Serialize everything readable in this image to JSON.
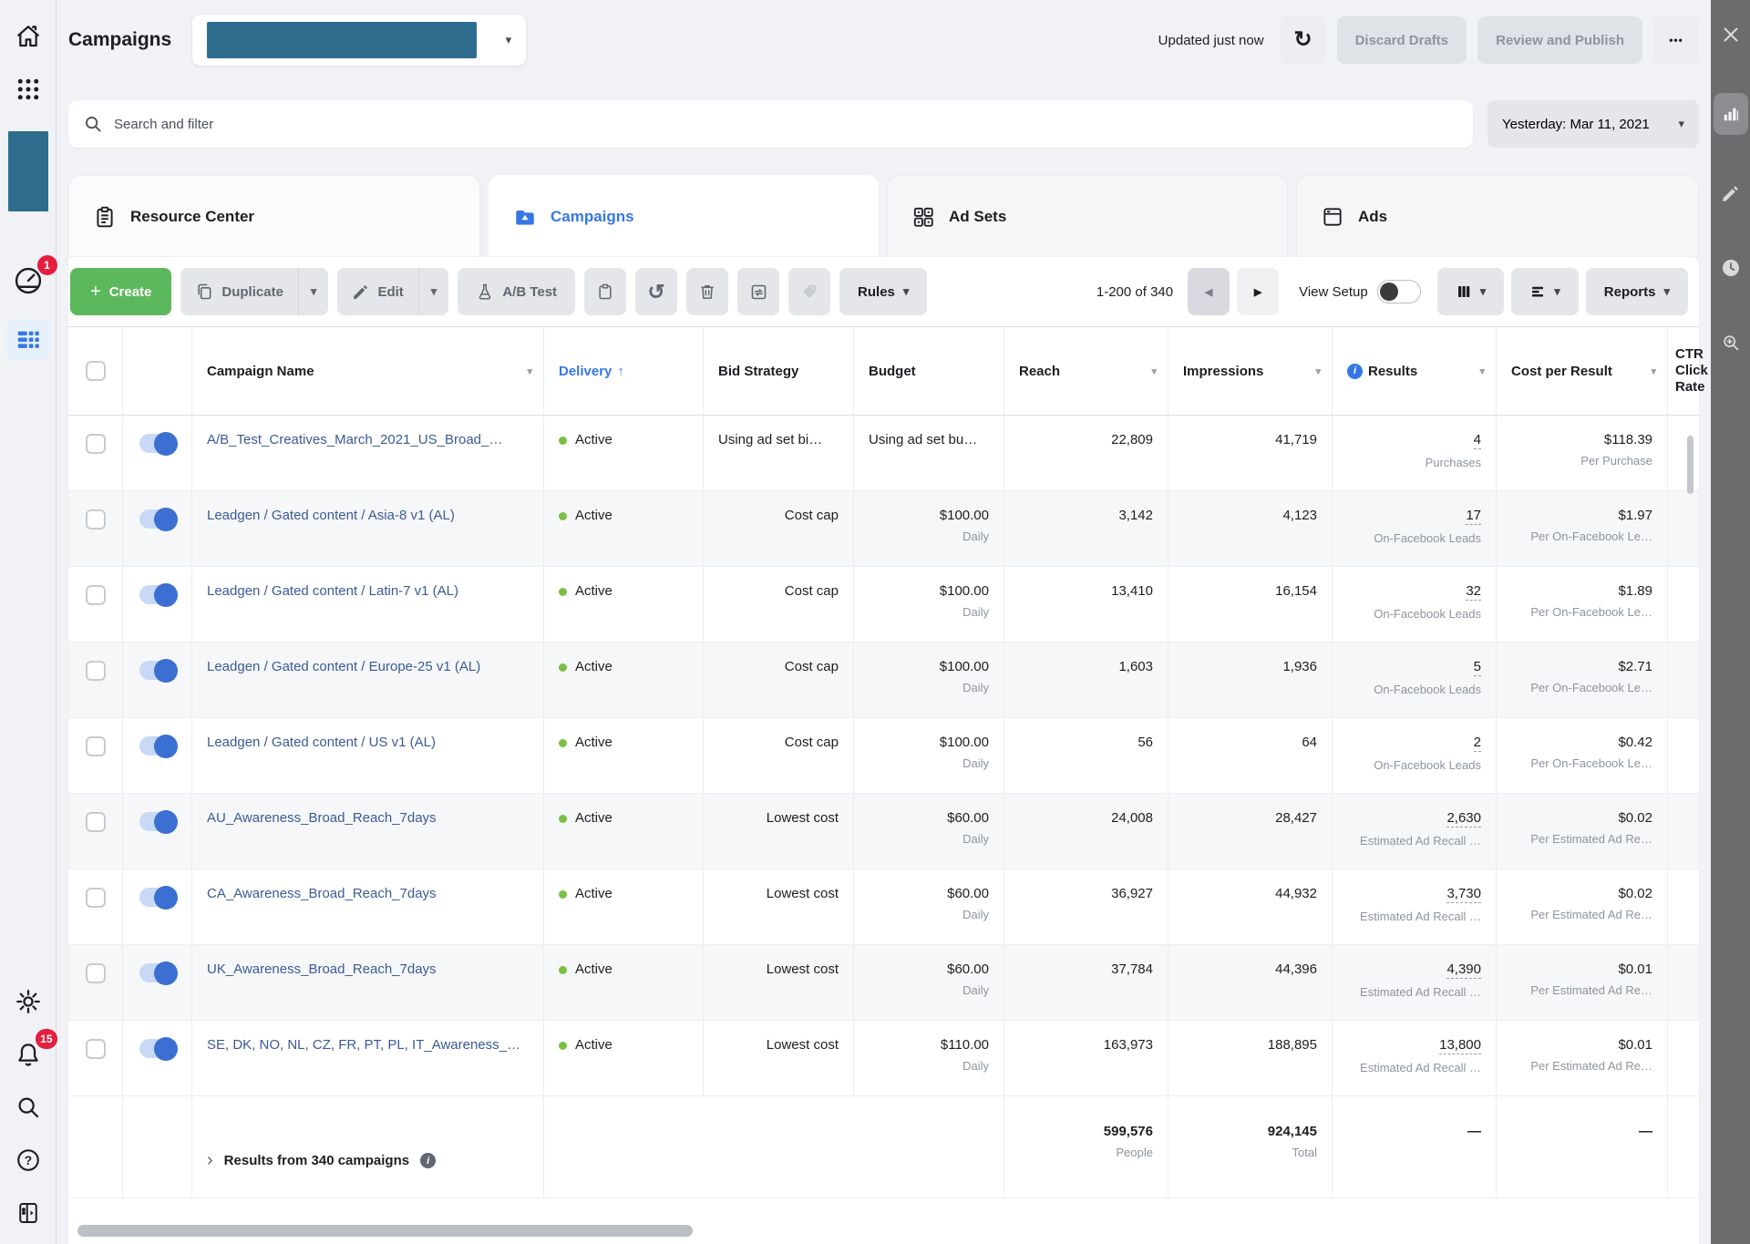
{
  "colors": {
    "accent_blue": "#3578e5",
    "create_green": "#5cb85c",
    "brand_teal": "#2e6d8e",
    "badge_red": "#e41e3f",
    "link_blue": "#3b5a98",
    "active_dot_green": "#7ac043",
    "rail_dark": "#6a6c6e"
  },
  "icons": {
    "caret": "▾",
    "sort_caret": "▾",
    "arrow_up": "↑",
    "prev": "◀",
    "next": "▶",
    "more": "•••",
    "plus": "+",
    "chevron_right": "›",
    "undo": "↺",
    "refresh": "↻",
    "question": "?",
    "info": "i"
  },
  "left_sidebar": {
    "reporting_badge": "1",
    "notifications_badge": "15"
  },
  "header": {
    "title": "Campaigns",
    "updated": "Updated just now",
    "discard_label": "Discard Drafts",
    "review_label": "Review and Publish"
  },
  "search": {
    "placeholder": "Search and filter",
    "date_range": "Yesterday: Mar 11, 2021"
  },
  "tabs": [
    {
      "label": "Resource Center"
    },
    {
      "label": "Campaigns"
    },
    {
      "label": "Ad Sets"
    },
    {
      "label": "Ads"
    }
  ],
  "toolbar": {
    "create": "Create",
    "duplicate": "Duplicate",
    "edit": "Edit",
    "ab_test": "A/B Test",
    "rules": "Rules",
    "count": "1-200 of 340",
    "view_setup": "View Setup",
    "reports": "Reports"
  },
  "table": {
    "columns": [
      "Campaign Name",
      "Delivery",
      "Bid Strategy",
      "Budget",
      "Reach",
      "Impressions",
      "Results",
      "Cost per Result",
      "CTR Click Rate"
    ],
    "rows": [
      {
        "name": "A/B_Test_Creatives_March_2021_US_Broad_…",
        "status": "Active",
        "bid": "Using ad set bi…",
        "budget": "Using ad set bu…",
        "budget_sub": "",
        "reach": "22,809",
        "impressions": "41,719",
        "results": "4",
        "results_sub": "Purchases",
        "cost": "$118.39",
        "cost_sub": "Per Purchase"
      },
      {
        "name": "Leadgen / Gated content / Asia-8 v1 (AL)",
        "status": "Active",
        "bid": "Cost cap",
        "budget": "$100.00",
        "budget_sub": "Daily",
        "reach": "3,142",
        "impressions": "4,123",
        "results": "17",
        "results_sub": "On-Facebook Leads",
        "cost": "$1.97",
        "cost_sub": "Per On-Facebook Le…"
      },
      {
        "name": "Leadgen / Gated content / Latin-7 v1 (AL)",
        "status": "Active",
        "bid": "Cost cap",
        "budget": "$100.00",
        "budget_sub": "Daily",
        "reach": "13,410",
        "impressions": "16,154",
        "results": "32",
        "results_sub": "On-Facebook Leads",
        "cost": "$1.89",
        "cost_sub": "Per On-Facebook Le…"
      },
      {
        "name": "Leadgen / Gated content / Europe-25 v1 (AL)",
        "status": "Active",
        "bid": "Cost cap",
        "budget": "$100.00",
        "budget_sub": "Daily",
        "reach": "1,603",
        "impressions": "1,936",
        "results": "5",
        "results_sub": "On-Facebook Leads",
        "cost": "$2.71",
        "cost_sub": "Per On-Facebook Le…"
      },
      {
        "name": "Leadgen / Gated content / US v1 (AL)",
        "status": "Active",
        "bid": "Cost cap",
        "budget": "$100.00",
        "budget_sub": "Daily",
        "reach": "56",
        "impressions": "64",
        "results": "2",
        "results_sub": "On-Facebook Leads",
        "cost": "$0.42",
        "cost_sub": "Per On-Facebook Le…"
      },
      {
        "name": "AU_Awareness_Broad_Reach_7days",
        "status": "Active",
        "bid": "Lowest cost",
        "budget": "$60.00",
        "budget_sub": "Daily",
        "reach": "24,008",
        "impressions": "28,427",
        "results": "2,630",
        "results_sub": "Estimated Ad Recall …",
        "cost": "$0.02",
        "cost_sub": "Per Estimated Ad Re…"
      },
      {
        "name": "CA_Awareness_Broad_Reach_7days",
        "status": "Active",
        "bid": "Lowest cost",
        "budget": "$60.00",
        "budget_sub": "Daily",
        "reach": "36,927",
        "impressions": "44,932",
        "results": "3,730",
        "results_sub": "Estimated Ad Recall …",
        "cost": "$0.02",
        "cost_sub": "Per Estimated Ad Re…"
      },
      {
        "name": "UK_Awareness_Broad_Reach_7days",
        "status": "Active",
        "bid": "Lowest cost",
        "budget": "$60.00",
        "budget_sub": "Daily",
        "reach": "37,784",
        "impressions": "44,396",
        "results": "4,390",
        "results_sub": "Estimated Ad Recall …",
        "cost": "$0.01",
        "cost_sub": "Per Estimated Ad Re…"
      },
      {
        "name": "SE, DK, NO, NL, CZ, FR, PT, PL, IT_Awareness_…",
        "status": "Active",
        "bid": "Lowest cost",
        "budget": "$110.00",
        "budget_sub": "Daily",
        "reach": "163,973",
        "impressions": "188,895",
        "results": "13,800",
        "results_sub": "Estimated Ad Recall …",
        "cost": "$0.01",
        "cost_sub": "Per Estimated Ad Re…"
      }
    ],
    "footer": {
      "label": "Results from 340 campaigns",
      "reach": "599,576",
      "reach_sub": "People",
      "impressions": "924,145",
      "impressions_sub": "Total",
      "results": "—",
      "cost": "—"
    }
  }
}
